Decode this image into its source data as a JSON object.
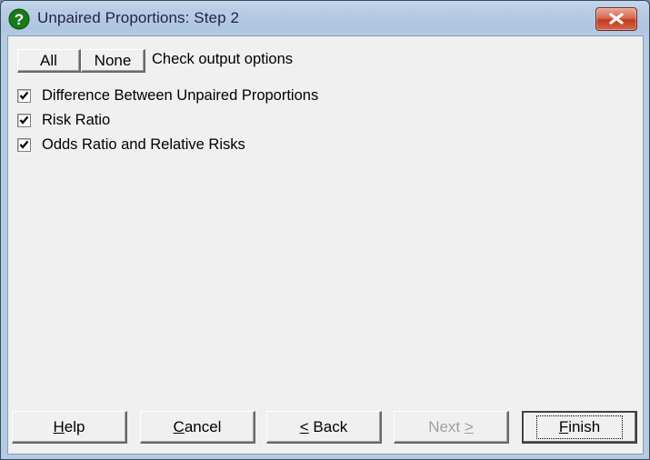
{
  "window": {
    "title": "Unpaired Proportions: Step 2",
    "icon": "help-question-icon",
    "close_label": "close"
  },
  "header": {
    "all_label": "All",
    "none_label": "None",
    "instruction": "Check output options"
  },
  "options": [
    {
      "label": "Difference Between Unpaired Proportions",
      "checked": true
    },
    {
      "label": "Risk Ratio",
      "checked": true
    },
    {
      "label": "Odds Ratio and Relative Risks",
      "checked": true
    }
  ],
  "footer": {
    "help": {
      "prefix": "",
      "accel": "H",
      "rest": "elp"
    },
    "cancel": {
      "prefix": "",
      "accel": "C",
      "rest": "ancel"
    },
    "back": {
      "prefix": "",
      "accel": "<",
      "rest": " Back"
    },
    "next": {
      "prefix": "Next ",
      "accel": ">",
      "rest": "",
      "disabled": true
    },
    "finish": {
      "prefix": "",
      "accel": "F",
      "rest": "inish"
    }
  },
  "colors": {
    "title_text": "#2a1b4e",
    "dialog_bg": "#f0f0f0",
    "close_red": "#c23a1c",
    "icon_green": "#1a7a1a"
  }
}
